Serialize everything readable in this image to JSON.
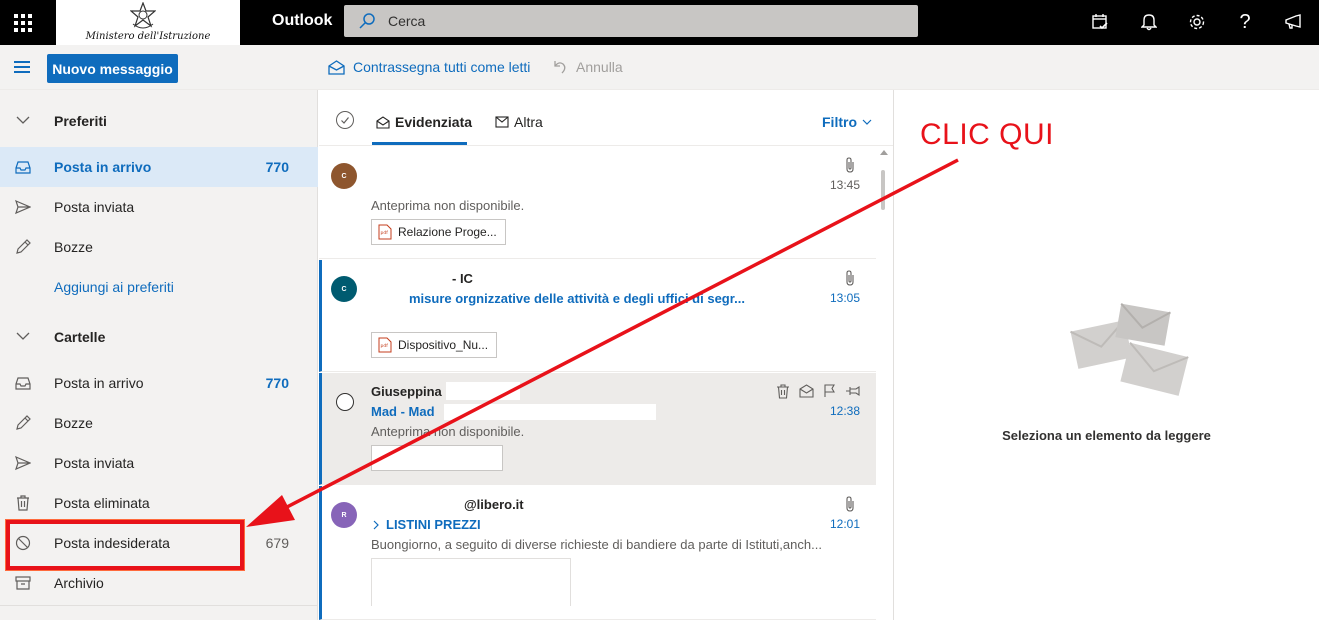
{
  "topbar": {
    "brand": "Outlook",
    "logo_text": "Ministero dell'Istruzione",
    "search_placeholder": "Cerca",
    "icons": [
      "calendar-check-icon",
      "bell-icon",
      "gear-icon",
      "help-icon",
      "megaphone-icon"
    ],
    "help_glyph": "?"
  },
  "commandbar": {
    "new_message": "Nuovo messaggio",
    "mark_all_read": "Contrassegna tutti come letti",
    "undo": "Annulla"
  },
  "sidebar": {
    "favorites_header": "Preferiti",
    "favorites": [
      {
        "label": "Posta in arrivo",
        "count": "770",
        "icon": "inbox-icon",
        "selected": true
      },
      {
        "label": "Posta inviata",
        "count": "",
        "icon": "send-icon"
      },
      {
        "label": "Bozze",
        "count": "",
        "icon": "pencil-icon"
      }
    ],
    "add_favorite": "Aggiungi ai preferiti",
    "folders_header": "Cartelle",
    "folders": [
      {
        "label": "Posta in arrivo",
        "count": "770",
        "icon": "inbox-icon"
      },
      {
        "label": "Bozze",
        "count": "",
        "icon": "pencil-icon"
      },
      {
        "label": "Posta inviata",
        "count": "",
        "icon": "send-icon"
      },
      {
        "label": "Posta eliminata",
        "count": "",
        "icon": "trash-icon"
      },
      {
        "label": "Posta indesiderata",
        "count": "679",
        "icon": "block-icon"
      },
      {
        "label": "Archivio",
        "count": "",
        "icon": "archive-icon"
      }
    ]
  },
  "list": {
    "tabs": [
      {
        "label": "Evidenziata",
        "active": true
      },
      {
        "label": "Altra",
        "active": false
      }
    ],
    "filter": "Filtro",
    "messages": [
      {
        "avatar": "C",
        "avatar_color": "#8e562e",
        "sender": "",
        "subject": "",
        "time": "13:45",
        "preview": "Anteprima non disponibile.",
        "attachment": "Relazione Proge..."
      },
      {
        "avatar": "C",
        "avatar_color": "#005b70",
        "sender": "- IC",
        "subject": "misure orgnizzative delle attività e degli uffici di segr...",
        "time": "13:05",
        "preview": "",
        "attachment": "Dispositivo_Nu..."
      },
      {
        "avatar": "",
        "sender": "Giuseppina",
        "subject": "Mad - Mad",
        "time": "12:38",
        "preview": "Anteprima non disponibile.",
        "attachment": ""
      },
      {
        "avatar": "R",
        "avatar_color": "#8764b8",
        "sender": "@libero.it",
        "subject": "LISTINI PREZZI",
        "time": "12:01",
        "preview": "Buongiorno, a seguito di diverse richieste di bandiere da parte di Istituti,anch...",
        "attachment": ""
      }
    ]
  },
  "reading": {
    "empty_text": "Seleziona un elemento da leggere"
  },
  "annotation": {
    "text": "CLIC QUI",
    "color": "#e8121a"
  },
  "colors": {
    "accent": "#0f6cbd",
    "topbar": "#000000",
    "nav_bg": "#f3f2f1"
  }
}
